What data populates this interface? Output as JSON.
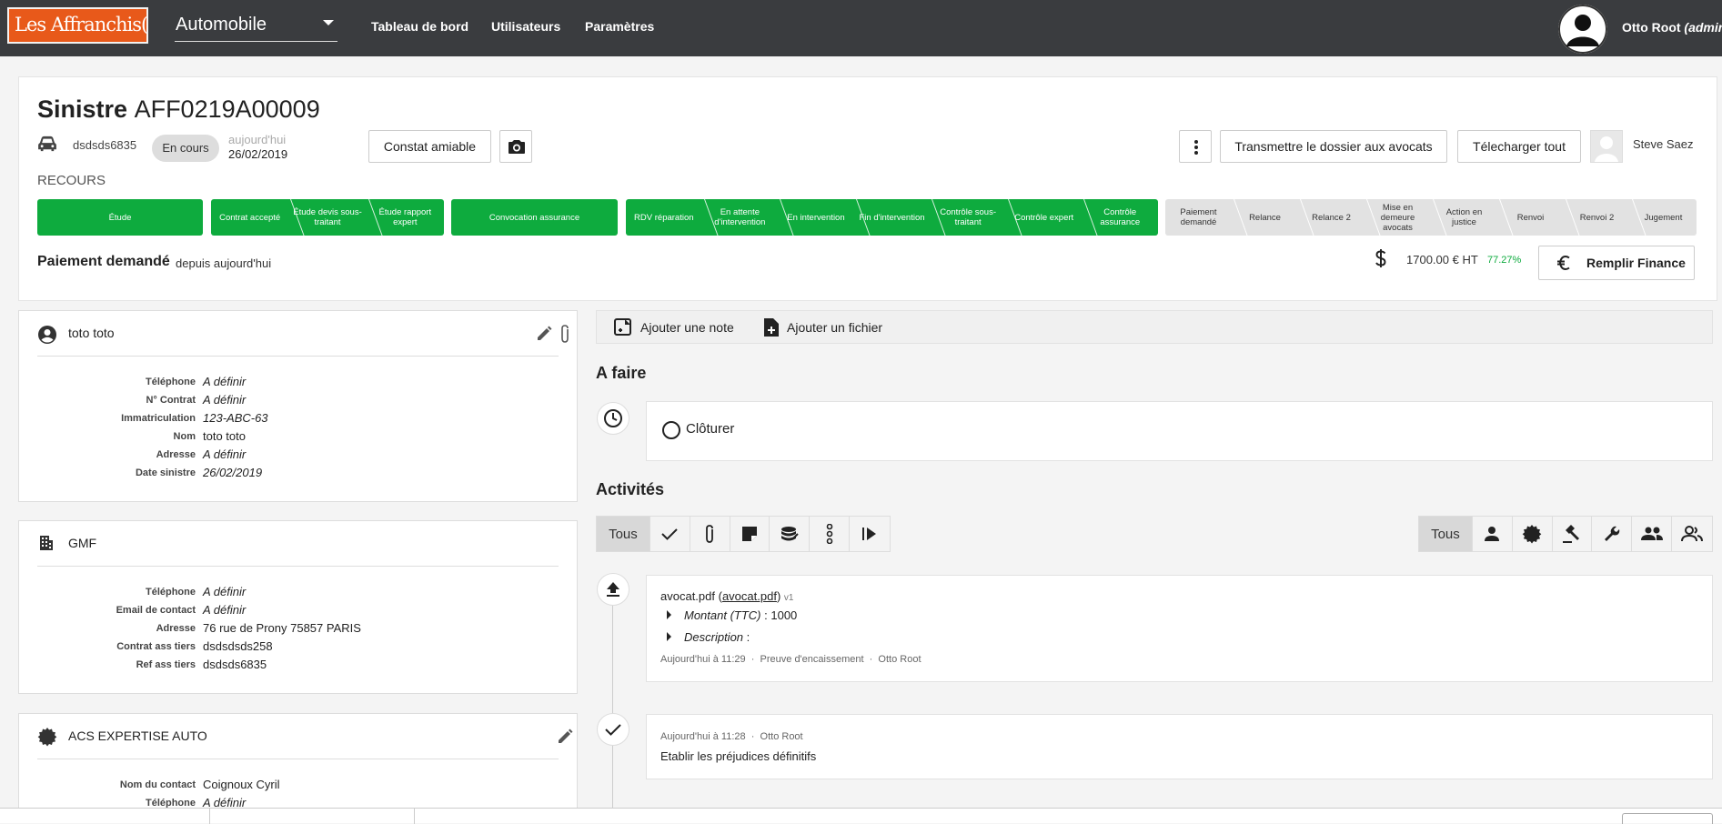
{
  "nav": {
    "logo": "Les Affranchis(e)",
    "domain": "Automobile",
    "links": [
      "Tableau de bord",
      "Utilisateurs",
      "Paramètres"
    ],
    "user_name": "Otto Root",
    "user_role": "(admin)"
  },
  "header": {
    "title": "Sinistre",
    "ref": "AFF0219A00009",
    "plate": "dsdsds6835",
    "status": "En cours",
    "date_rel": "aujourd'hui",
    "date": "26/02/2019",
    "constat_button": "Constat amiable",
    "transmit_button": "Transmettre le dossier aux avocats",
    "download_button": "Télecharger tout",
    "assignee": "Steve Saez",
    "category": "RECOURS",
    "stage_groups": [
      {
        "stages": [
          "Étude"
        ]
      },
      {
        "stages": [
          "Contrat accepté",
          "Étude devis sous-traitant",
          "Étude rapport expert"
        ]
      },
      {
        "stages": [
          "Convocation assurance"
        ]
      },
      {
        "stages": [
          "RDV réparation",
          "En attente d'intervention",
          "En intervention",
          "Fin d'intervention",
          "Contrôle sous-traitant",
          "Contrôle expert",
          "Contrôle assurance"
        ]
      },
      {
        "stages": [
          "Paiement demandé",
          "Relance",
          "Relance 2",
          "Mise en demeure avocats",
          "Action en justice",
          "Renvoi",
          "Renvoi 2",
          "Jugement"
        ]
      }
    ],
    "current_state": "Paiement demandé",
    "current_since": "depuis aujourd'hui",
    "amount": "1700.00 € HT",
    "percent": "77.27%",
    "finance_button": "Remplir Finance"
  },
  "client_card": {
    "name": "toto toto",
    "rows": [
      {
        "k": "Téléphone",
        "v": "A définir"
      },
      {
        "k": "N° Contrat",
        "v": "A définir"
      },
      {
        "k": "Immatriculation",
        "v": "123-ABC-63"
      },
      {
        "k": "Nom",
        "v": "toto toto"
      },
      {
        "k": "Adresse",
        "v": "A définir"
      },
      {
        "k": "Date sinistre",
        "v": "26/02/2019"
      }
    ]
  },
  "insurer_card": {
    "name": "GMF",
    "rows": [
      {
        "k": "Téléphone",
        "v": "A définir"
      },
      {
        "k": "Email de contact",
        "v": "A définir"
      },
      {
        "k": "Adresse",
        "v": "76 rue de Prony 75857 PARIS"
      },
      {
        "k": "Contrat ass tiers",
        "v": "dsdsdsds258"
      },
      {
        "k": "Ref ass tiers",
        "v": "dsdsds6835"
      }
    ]
  },
  "expert_card": {
    "name": "ACS EXPERTISE AUTO",
    "rows": [
      {
        "k": "Nom du contact",
        "v": "Coignoux Cyril"
      },
      {
        "k": "Téléphone",
        "v": "A définir"
      }
    ]
  },
  "actions": {
    "add_note": "Ajouter une note",
    "add_file": "Ajouter un fichier"
  },
  "todo": {
    "title": "A faire",
    "item": "Clôturer"
  },
  "activities": {
    "title": "Activités",
    "filter_all": "Tous",
    "filter_all_2": "Tous",
    "items": [
      {
        "file": "avocat.pdf",
        "link": "avocat.pdf",
        "version": "v1",
        "amount_label": "Montant (TTC)",
        "amount_value": ": 1000",
        "desc_label": "Description",
        "desc_value": ":",
        "meta_time": "Aujourd'hui à 11:29",
        "meta_type": "Preuve d'encaissement",
        "meta_user": "Otto Root"
      },
      {
        "meta_time": "Aujourd'hui à 11:28",
        "meta_user": "Otto Root",
        "text": "Etablir les préjudices définitifs"
      }
    ]
  },
  "colors": {
    "nav": "#3a3c3f",
    "accent": "#0eab3e",
    "logo": "#e8591a"
  }
}
